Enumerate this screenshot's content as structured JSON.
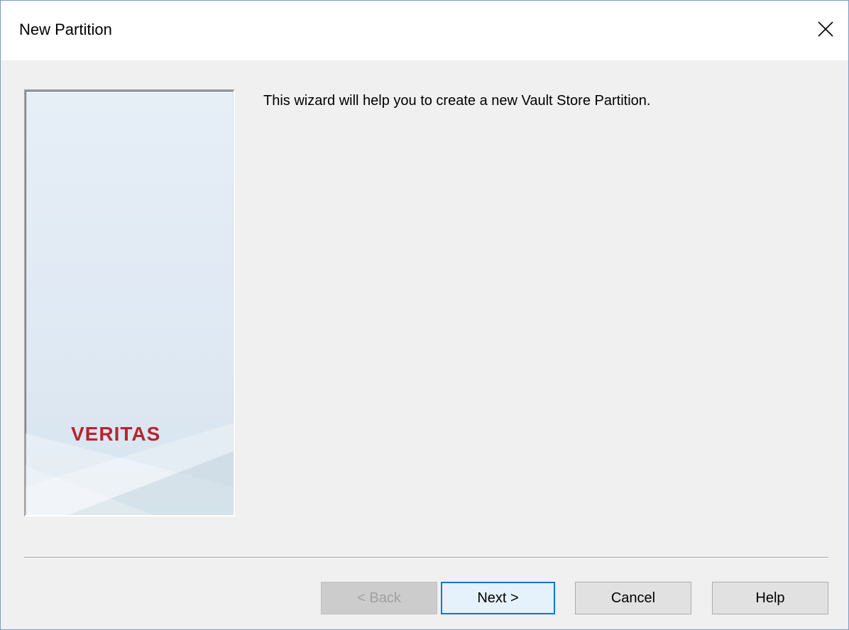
{
  "window": {
    "title": "New Partition",
    "close_icon": "close-icon"
  },
  "banner": {
    "logo_text": "VERITAS",
    "logo_color": "#b5252f"
  },
  "main": {
    "intro_text": "This wizard will help you to create a new Vault Store Partition."
  },
  "buttons": {
    "back": {
      "label": "< Back",
      "enabled": false
    },
    "next": {
      "label": "Next >",
      "enabled": true,
      "default": true
    },
    "cancel": {
      "label": "Cancel",
      "enabled": true
    },
    "help": {
      "label": "Help",
      "enabled": true
    }
  },
  "colors": {
    "accent": "#0078d7",
    "dialog_background": "#f0f0f0",
    "title_background": "#ffffff"
  }
}
